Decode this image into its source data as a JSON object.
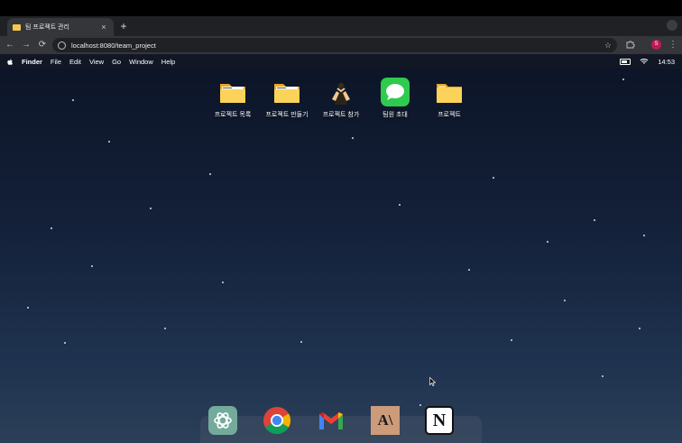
{
  "browser": {
    "tab_title": "팀 프로젝트 관리",
    "tab_close": "×",
    "new_tab": "+",
    "url": "localhost:8080/team_project",
    "profile_initial": "S",
    "nav": {
      "back": "←",
      "forward": "→",
      "reload": "⟳",
      "menu": "⋮",
      "star": "☆"
    }
  },
  "menubar": {
    "items": [
      "Finder",
      "File",
      "Edit",
      "View",
      "Go",
      "Window",
      "Help"
    ],
    "time": "14:53"
  },
  "desktop_icons": [
    {
      "label": "프로젝트 목록",
      "icon": "folder-icon"
    },
    {
      "label": "프로젝트 만들기",
      "icon": "folder-icon"
    },
    {
      "label": "프로젝트 참가",
      "icon": "raised-hands-icon"
    },
    {
      "label": "팀원 초대",
      "icon": "messages-icon"
    },
    {
      "label": "프로젝트",
      "icon": "folder-icon"
    }
  ],
  "dock_apps": [
    {
      "name": "ChatGPT",
      "icon": "chatgpt-icon"
    },
    {
      "name": "Chrome",
      "icon": "chrome-icon"
    },
    {
      "name": "Gmail",
      "icon": "gmail-icon"
    },
    {
      "name": "Claude",
      "icon": "anthropic-icon",
      "glyph": "A\\"
    },
    {
      "name": "Notion",
      "icon": "notion-icon",
      "glyph": "N"
    }
  ]
}
